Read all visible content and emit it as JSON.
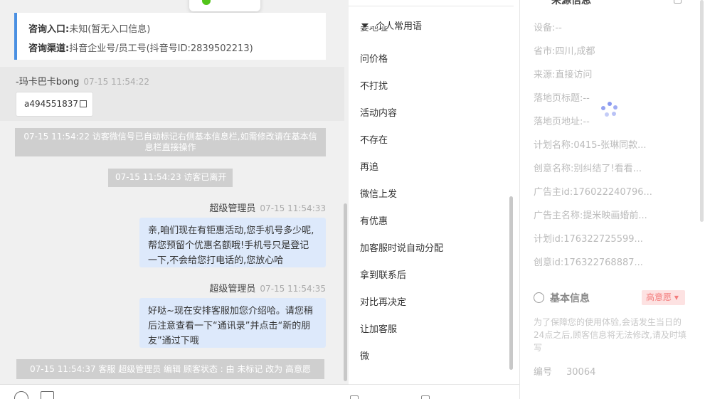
{
  "source": {
    "entry_label": "咨询入口:",
    "entry_value": "未知(暂无入口信息)",
    "channel_label": "咨询渠道:",
    "channel_value": "抖音企业号/员工号(抖音号ID:2839502213)"
  },
  "visitor": {
    "name": "-玛卡巴卡bong",
    "time": "07-15 11:54:22",
    "id_card": "a494551837"
  },
  "system_messages": [
    "07-15 11:54:22 访客微信号已自动标记右侧基本信息栏,如需修改请在基本信息栏直接操作",
    "07-15 11:54:23 访客已离开",
    "07-15 11:54:37 客服 超级管理员 编辑 顾客状态 : 由 未标记 改为 高意愿"
  ],
  "agent_messages": [
    {
      "name": "超级管理员",
      "time": "07-15 11:54:33",
      "text": "亲,咱们现在有钜惠活动,您手机号多少呢,帮您预留个优惠名额哦!手机号只是登记一下,不会给您打电话的,您放心哈"
    },
    {
      "name": "超级管理员",
      "time": "07-15 11:54:35",
      "text": "好哒~现在安排客服加您介绍哈。请您稍后注意查看一下“通讯录”并点击“新的朋友”通过下哦"
    }
  ],
  "phrases": {
    "group": "个人常用语",
    "cut_item": "要地址",
    "items": [
      "问价格",
      "不打扰",
      "活动内容",
      "不存在",
      "再追",
      "微信上发",
      "有优惠",
      "加客服时说自动分配",
      "拿到联系后",
      "对比再决定",
      "让加客服",
      "微"
    ]
  },
  "info": {
    "header": "来源信息",
    "rows": [
      {
        "label": "设备:",
        "value": "--"
      },
      {
        "label": "省市:",
        "value": "四川,成都"
      },
      {
        "label": "来源:",
        "value": "直接访问"
      },
      {
        "label": "落地页标题:",
        "value": "--"
      },
      {
        "label": "落地页地址:",
        "value": "--"
      },
      {
        "label": "计划名称:",
        "value": "0415-张琳同款..."
      },
      {
        "label": "创意名称:",
        "value": "别纠结了!看看..."
      },
      {
        "label": "广告主id:",
        "value": "176022240796..."
      },
      {
        "label": "广告主名称:",
        "value": "提米映画婚前..."
      },
      {
        "label": "计划id:",
        "value": "176322725599..."
      },
      {
        "label": "创意id:",
        "value": "176322768887..."
      }
    ],
    "basic_title": "基本信息",
    "badge": "高意愿",
    "notice": "为了保障您的使用体验,会话发生当日的24点之后,顾客信息将无法修改,请及时填写",
    "code_label": "编号",
    "code_value": "30064"
  },
  "colors": {
    "accent": "#4a90e2",
    "agent_bubble": "#dde9fb",
    "system_bg": "#cfcfcf",
    "badge_bg": "#fde2e2",
    "badge_text": "#f37b7b"
  }
}
